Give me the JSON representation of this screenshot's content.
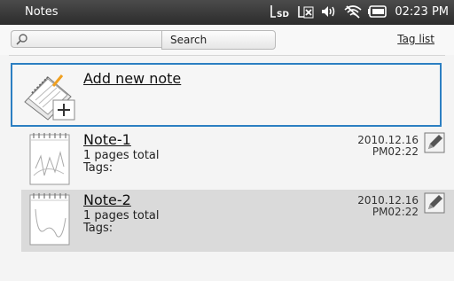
{
  "status_bar": {
    "app_title": "Notes",
    "sd_label": "SD",
    "time": "02:23 PM"
  },
  "search": {
    "placeholder": "",
    "button_label": "Search",
    "tag_list_label": "Tag list"
  },
  "add_note": {
    "label": "Add new note"
  },
  "notes": [
    {
      "name": "Note-1",
      "pages": "1 pages total",
      "tags": "Tags:",
      "date": "2010.12.16",
      "time": "PM02:22"
    },
    {
      "name": "Note-2",
      "pages": "1 pages total",
      "tags": "Tags:",
      "date": "2010.12.16",
      "time": "PM02:22"
    }
  ],
  "colors": {
    "accent": "#2c7fc2",
    "selected_row": "#dadada"
  }
}
